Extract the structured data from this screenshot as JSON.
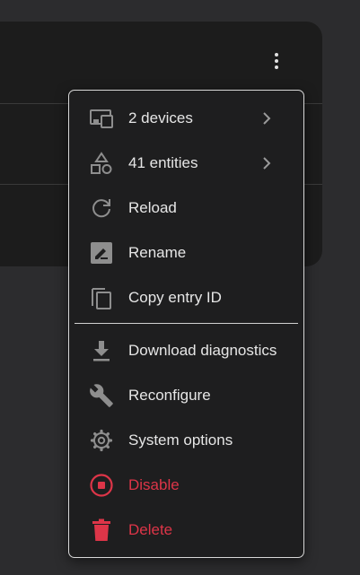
{
  "menu": {
    "items": [
      {
        "label": "2 devices",
        "icon": "devices-icon",
        "submenu": true
      },
      {
        "label": "41 entities",
        "icon": "shapes-icon",
        "submenu": true
      },
      {
        "label": "Reload",
        "icon": "reload-icon"
      },
      {
        "label": "Rename",
        "icon": "rename-icon"
      },
      {
        "label": "Copy entry ID",
        "icon": "copy-icon"
      },
      {
        "label": "Download diagnostics",
        "icon": "download-icon"
      },
      {
        "label": "Reconfigure",
        "icon": "wrench-icon"
      },
      {
        "label": "System options",
        "icon": "gear-icon"
      },
      {
        "label": "Disable",
        "icon": "stop-circle-icon",
        "danger": true
      },
      {
        "label": "Delete",
        "icon": "trash-icon",
        "danger": true
      }
    ]
  },
  "colors": {
    "page_background": "#2c2c2e",
    "card_background": "#1c1c1c",
    "menu_background": "#1e1e1f",
    "text": "#e6e6e6",
    "icon": "#8e8e8e",
    "danger": "#dd3548"
  }
}
